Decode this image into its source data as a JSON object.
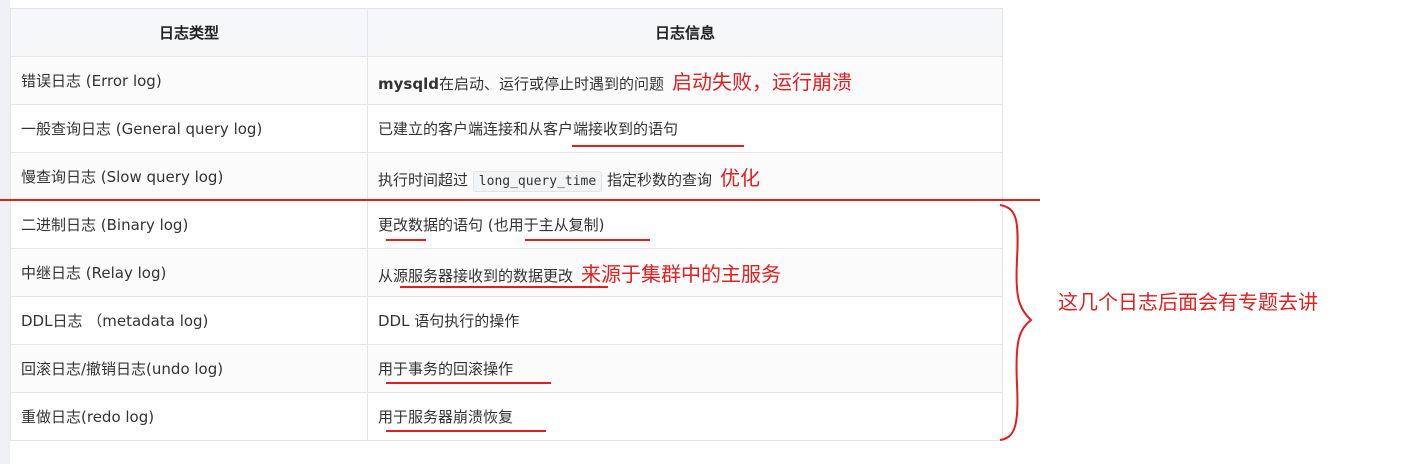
{
  "table": {
    "headers": [
      "日志类型",
      "日志信息"
    ],
    "rows": [
      {
        "type": "错误日志 (Error log)",
        "info_strong": "mysqld",
        "info": "在启动、运行或停止时遇到的问题",
        "annotation": "启动失败，运行崩溃"
      },
      {
        "type": "一般查询日志 (General query log)",
        "info": "已建立的客户端连接和从客户端接收到的语句"
      },
      {
        "type": "慢查询日志 (Slow query log)",
        "info_pre": "执行时间超过",
        "info_code": "long_query_time",
        "info": "指定秒数的查询",
        "annotation": "优化"
      },
      {
        "type": "二进制日志 (Binary log)",
        "info": "更改数据的语句 (也用于主从复制)"
      },
      {
        "type": "中继日志 (Relay log)",
        "info": "从源服务器接收到的数据更改",
        "annotation": "来源于集群中的主服务"
      },
      {
        "type": "DDL日志 （metadata log)",
        "info": "DDL 语句执行的操作"
      },
      {
        "type": "回滚日志/撤销日志(undo log)",
        "info": "用于事务的回滚操作"
      },
      {
        "type": "重做日志(redo log)",
        "info": "用于服务器崩溃恢复"
      }
    ]
  },
  "side_note": "这几个日志后面会有专题去讲",
  "colors": {
    "annotation_red": "#e02020",
    "header_bg": "#f6f7f9",
    "border": "#e4e6ea"
  }
}
